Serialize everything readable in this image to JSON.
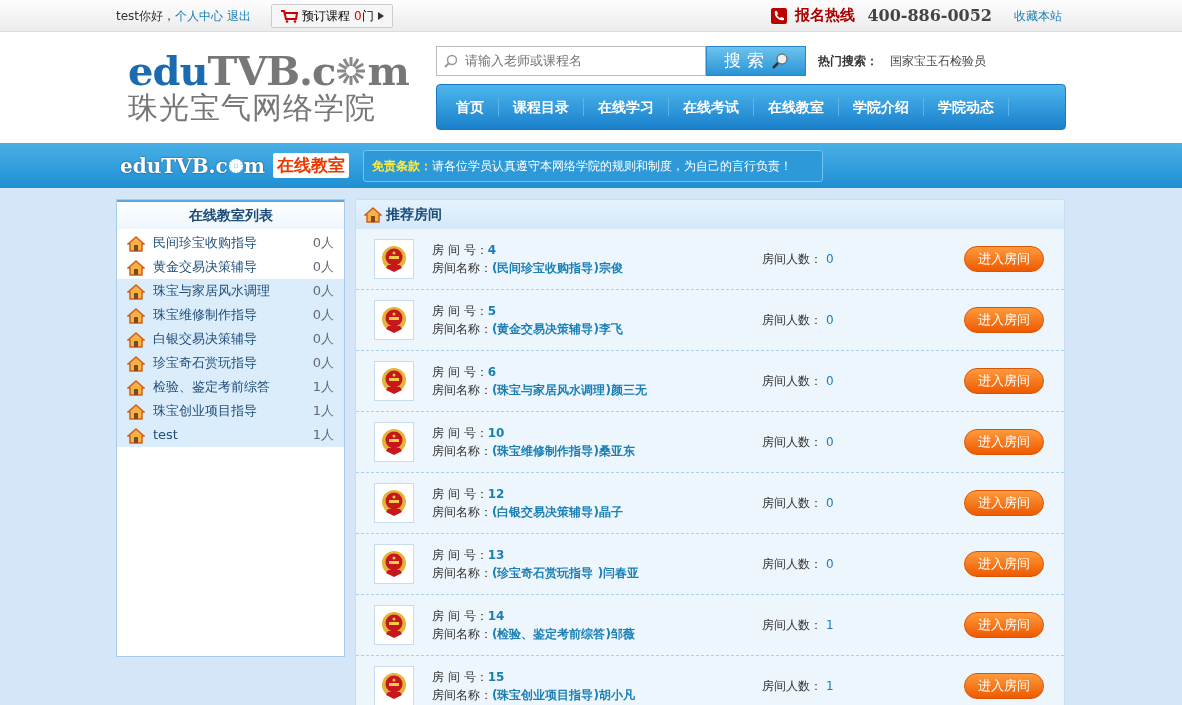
{
  "topbar": {
    "greeting": "test你好，",
    "links": [
      "个人中心",
      "退出"
    ],
    "cart": {
      "label": "预订课程",
      "count": "0",
      "unit": "门"
    },
    "hotline_label": "报名热线",
    "hotline": "400-886-0052",
    "bookmark": "收藏本站"
  },
  "logo": {
    "prefix": "eduTVB.c",
    "suffix": "m",
    "subtitle": "珠光宝气网络学院"
  },
  "search": {
    "placeholder": "请输入老师或课程名",
    "button": "搜 索",
    "hot_label": "热门搜索：",
    "hot_terms": [
      "国家宝玉石检验员"
    ]
  },
  "nav": [
    {
      "label": "首页"
    },
    {
      "label": "课程目录"
    },
    {
      "label": "在线学习"
    },
    {
      "label": "在线考试"
    },
    {
      "label": "在线教室"
    },
    {
      "label": "学院介绍"
    },
    {
      "label": "学院动态"
    }
  ],
  "banner": {
    "logo_prefix": "eduTVB.c",
    "logo_suffix": "m",
    "title": "在线教室",
    "notice_label": "免责条款：",
    "notice": "请各位学员认真遵守本网络学院的规则和制度，为自己的言行负责！"
  },
  "sidebar": {
    "title": "在线教室列表",
    "items": [
      {
        "name": "民间珍宝收购指导",
        "count": "0人",
        "highlighted": false
      },
      {
        "name": "黄金交易决策辅导",
        "count": "0人",
        "highlighted": false
      },
      {
        "name": "珠宝与家居风水调理",
        "count": "0人",
        "highlighted": true
      },
      {
        "name": "珠宝维修制作指导",
        "count": "0人",
        "highlighted": true
      },
      {
        "name": "白银交易决策辅导",
        "count": "0人",
        "highlighted": true
      },
      {
        "name": "珍宝奇石赏玩指导",
        "count": "0人",
        "highlighted": true
      },
      {
        "name": "检验、鉴定考前综答",
        "count": "1人",
        "highlighted": true
      },
      {
        "name": "珠宝创业项目指导",
        "count": "1人",
        "highlighted": true
      },
      {
        "name": "test",
        "count": "1人",
        "highlighted": true
      }
    ]
  },
  "rooms": {
    "title": "推荐房间",
    "items": [
      {
        "number_label": "房 间 号：",
        "number": "4",
        "name_label": "房间名称：",
        "name": "(民间珍宝收购指导)宗俊",
        "people_label": "房间人数：",
        "people": "0",
        "button": "进入房间"
      },
      {
        "number_label": "房 间 号：",
        "number": "5",
        "name_label": "房间名称：",
        "name": "(黄金交易决策辅导)李飞",
        "people_label": "房间人数：",
        "people": "0",
        "button": "进入房间"
      },
      {
        "number_label": "房 间 号：",
        "number": "6",
        "name_label": "房间名称：",
        "name": "(珠宝与家居风水调理)颜三无",
        "people_label": "房间人数：",
        "people": "0",
        "button": "进入房间"
      },
      {
        "number_label": "房 间 号：",
        "number": "10",
        "name_label": "房间名称：",
        "name": "(珠宝维修制作指导)桑亚东",
        "people_label": "房间人数：",
        "people": "0",
        "button": "进入房间"
      },
      {
        "number_label": "房 间 号：",
        "number": "12",
        "name_label": "房间名称：",
        "name": "(白银交易决策辅导)晶子",
        "people_label": "房间人数：",
        "people": "0",
        "button": "进入房间"
      },
      {
        "number_label": "房 间 号：",
        "number": "13",
        "name_label": "房间名称：",
        "name": "(珍宝奇石赏玩指导 )闫春亚",
        "people_label": "房间人数：",
        "people": "0",
        "button": "进入房间"
      },
      {
        "number_label": "房 间 号：",
        "number": "14",
        "name_label": "房间名称：",
        "name": "(检验、鉴定考前综答)邹薇",
        "people_label": "房间人数：",
        "people": "1",
        "button": "进入房间"
      },
      {
        "number_label": "房 间 号：",
        "number": "15",
        "name_label": "房间名称：",
        "name": "(珠宝创业项目指导)胡小凡",
        "people_label": "房间人数：",
        "people": "1",
        "button": "进入房间"
      }
    ]
  }
}
